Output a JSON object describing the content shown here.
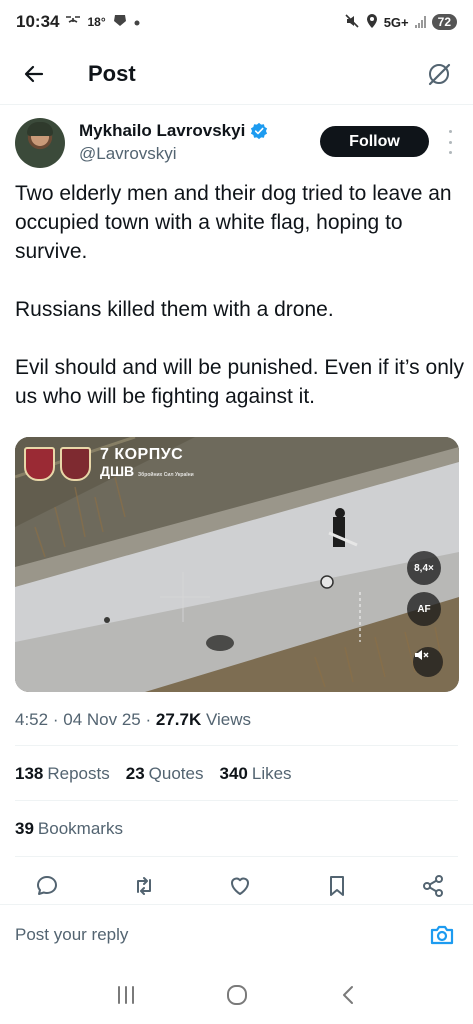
{
  "status_bar": {
    "time": "10:34",
    "temperature": "18°",
    "network": "5G+",
    "battery": "72",
    "icons": [
      "drone-icon",
      "weather-icon",
      "dot-icon",
      "mute-icon",
      "location-icon",
      "signal-icon",
      "battery-icon"
    ]
  },
  "header": {
    "title": "Post",
    "back_icon": "arrow-left-icon",
    "right_icon": "grok-icon"
  },
  "author": {
    "name": "Mykhailo Lavrovskyi",
    "handle": "@Lavrovskyi",
    "verified": true,
    "follow_label": "Follow"
  },
  "tweet": {
    "paragraphs": [
      "Two elderly men and their dog tried to leave an occupied town with a white flag, hoping to survive.",
      "Russians killed them with a drone.",
      "Evil should and will be punished. Even if it’s only us who will be fighting against it."
    ]
  },
  "media": {
    "brand_top": "7 КОРПУС",
    "brand_bottom": "ДШВ",
    "brand_sub": "Збройних Сил України",
    "controls": {
      "zoom": "8,4×",
      "focus": "AF"
    },
    "mute_icon": "volume-mute-icon"
  },
  "meta": {
    "time": "4:52",
    "date": "04 Nov 25",
    "views_count": "27.7K",
    "views_label": "Views",
    "separator": "·"
  },
  "stats": {
    "reposts_count": "138",
    "reposts_label": "Reposts",
    "quotes_count": "23",
    "quotes_label": "Quotes",
    "likes_count": "340",
    "likes_label": "Likes",
    "bookmarks_count": "39",
    "bookmarks_label": "Bookmarks"
  },
  "actions": [
    "reply-icon",
    "retweet-icon",
    "like-icon",
    "bookmark-icon",
    "share-icon"
  ],
  "reply": {
    "placeholder": "Post your reply",
    "camera_icon": "camera-icon"
  },
  "colors": {
    "text": "#0f1419",
    "secondary": "#536471",
    "accent": "#1d9bf0",
    "divider": "#eff3f4"
  }
}
